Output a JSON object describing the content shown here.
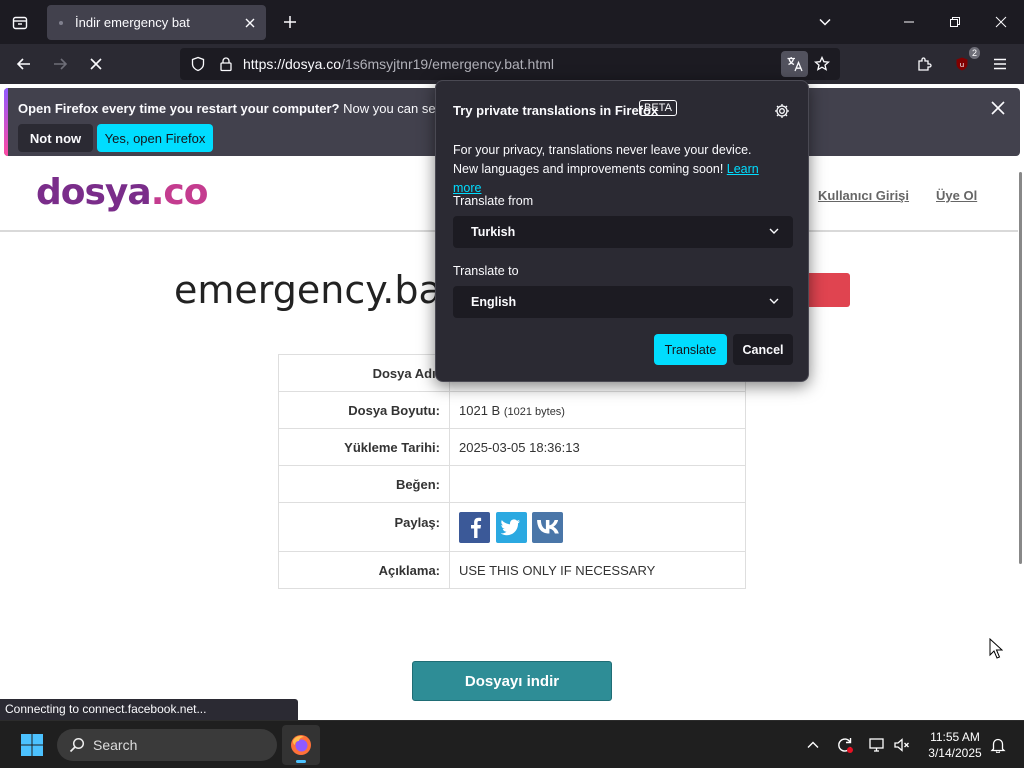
{
  "browser": {
    "tab_title": "İndir emergency bat",
    "url_host": "https://dosya.co",
    "url_path": "/1s6msyjtnr19/emergency.bat.html",
    "extension_badge": "2"
  },
  "notification": {
    "bold_text": "Open Firefox every time you restart your computer?",
    "text": " Now you can set Firefox",
    "not_now": "Not now",
    "yes_open": "Yes, open Firefox"
  },
  "site": {
    "logo_part1": "dosya",
    "logo_part2": ".co",
    "nav_login": "Kullanıcı Girişi",
    "nav_signup": "Üye Ol",
    "file_title": "emergency.bat",
    "rows": [
      {
        "key": "Dosya Adı:",
        "value": ""
      },
      {
        "key": "Dosya Boyutu:",
        "value": "1021 B",
        "value_small": "(1021 bytes)"
      },
      {
        "key": "Yükleme Tarihi:",
        "value": "2025-03-05 18:36:13"
      },
      {
        "key": "Beğen:",
        "value": ""
      },
      {
        "key": "Paylaş:",
        "value": ""
      },
      {
        "key": "Açıklama:",
        "value": "USE THIS ONLY IF NECESSARY"
      }
    ],
    "download_button": "Dosyayı indir"
  },
  "status_text": "Connecting to connect.facebook.net...",
  "translation_popup": {
    "title": "Try private translations in Firefox",
    "beta": "BETA",
    "description": "For your privacy, translations never leave your device. New languages and improvements coming soon!",
    "learn_more": "Learn more",
    "from_label": "Translate from",
    "from_value": "Turkish",
    "to_label": "Translate to",
    "to_value": "English",
    "translate_btn": "Translate",
    "cancel_btn": "Cancel"
  },
  "taskbar": {
    "search_label": "Search",
    "time": "11:55 AM",
    "date": "3/14/2025"
  },
  "colors": {
    "accent": "#00ddff",
    "download": "#2e8d96",
    "red_button": "#e04450",
    "logo_purple": "#7a2d8a",
    "logo_pink": "#c43c8f"
  }
}
